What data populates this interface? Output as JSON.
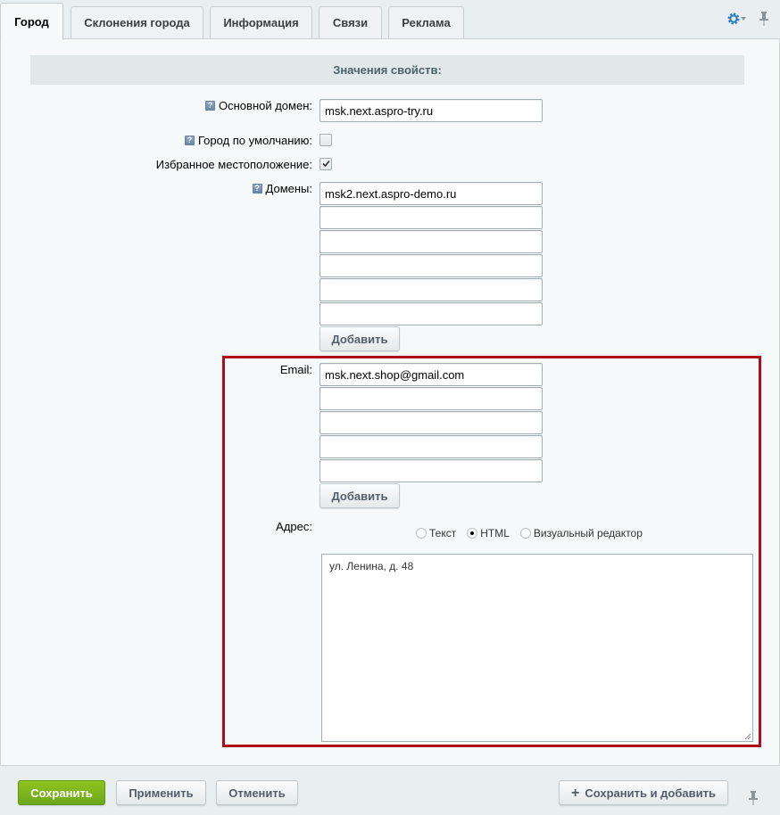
{
  "tabs": [
    {
      "label": "Город",
      "active": true
    },
    {
      "label": "Склонения города",
      "active": false
    },
    {
      "label": "Информация",
      "active": false
    },
    {
      "label": "Связи",
      "active": false
    },
    {
      "label": "Реклама",
      "active": false
    }
  ],
  "toolbar": {
    "settings_icon": "gear-icon",
    "pin_icon": "pin-icon"
  },
  "section": {
    "title": "Значения свойств:"
  },
  "fields": {
    "main_domain": {
      "label": "Основной домен:",
      "value": "msk.next.aspro-try.ru"
    },
    "default_city": {
      "label": "Город по умолчанию:",
      "checked": false
    },
    "favorite_location": {
      "label": "Избранное местоположение:",
      "checked": true
    },
    "domains": {
      "label": "Домены:",
      "values": [
        "msk2.next.aspro-demo.ru",
        "",
        "",
        "",
        "",
        ""
      ],
      "add_label": "Добавить"
    },
    "email": {
      "label": "Email:",
      "values": [
        "msk.next.shop@gmail.com",
        "",
        "",
        "",
        ""
      ],
      "add_label": "Добавить"
    },
    "address": {
      "label": "Адрес:",
      "modes": [
        "Текст",
        "HTML",
        "Визуальный редактор"
      ],
      "selected_mode": "HTML",
      "value": "ул. Ленина, д. 48"
    }
  },
  "footer": {
    "save_label": "Сохранить",
    "apply_label": "Применить",
    "cancel_label": "Отменить",
    "save_add_label": "Сохранить и добавить"
  },
  "colors": {
    "highlight": "#b00d1a",
    "primary_button": "#7ab51d",
    "settings_icon": "#2f7fc1"
  }
}
